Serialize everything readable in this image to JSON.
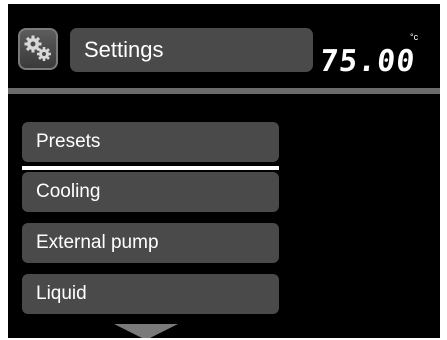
{
  "header": {
    "title": "Settings",
    "icon": "gears-icon"
  },
  "temperature": {
    "value": "75.00",
    "unit": "°c"
  },
  "menu": {
    "items": [
      {
        "label": "Presets",
        "selected": true
      },
      {
        "label": "Cooling",
        "selected": false
      },
      {
        "label": "External pump",
        "selected": false
      },
      {
        "label": "Liquid",
        "selected": false
      }
    ]
  },
  "colors": {
    "background": "#000000",
    "item_background": "#4a4a4a",
    "divider": "#6b6b6b",
    "text": "#ffffff",
    "selection": "#ffffff"
  }
}
